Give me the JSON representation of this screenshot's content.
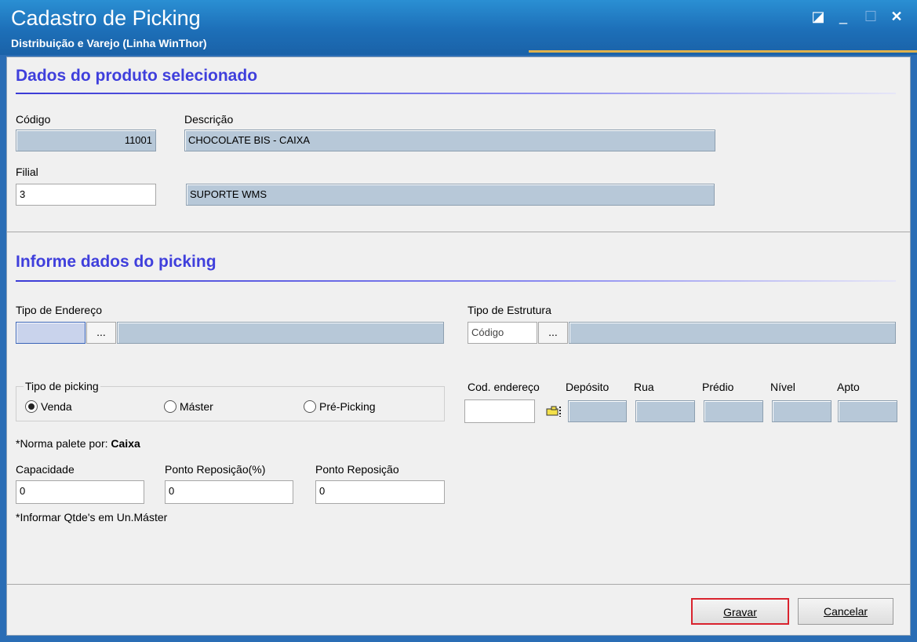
{
  "window": {
    "title": "Cadastro de Picking",
    "subtitle": "Distribuição e Varejo (Linha WinThor)",
    "controls": {
      "restore_icon": "◪",
      "minimize": "_",
      "maximize": "☐",
      "close": "✕"
    }
  },
  "product_section": {
    "title": "Dados do produto selecionado",
    "codigo_label": "Código",
    "codigo_value": "11001",
    "descricao_label": "Descrição",
    "descricao_value": "CHOCOLATE BIS  - CAIXA",
    "filial_label": "Filial",
    "filial_value": "3",
    "filial_name": "SUPORTE WMS"
  },
  "picking_section": {
    "title": "Informe dados do picking",
    "tipo_endereco_label": "Tipo de Endereço",
    "tipo_endereco_value": "",
    "tipo_estrutura_label": "Tipo de Estrutura",
    "tipo_estrutura_placeholder": "Código",
    "browse_label": "...",
    "tipo_picking_label": "Tipo de picking",
    "radios": [
      {
        "label": "Venda",
        "selected": true
      },
      {
        "label": "Máster",
        "selected": false
      },
      {
        "label": "Pré-Picking",
        "selected": false
      }
    ],
    "address_headers": {
      "cod_endereco": "Cod. endereço",
      "deposito": "Depósito",
      "rua": "Rua",
      "predio": "Prédio",
      "nivel": "Nível",
      "apto": "Apto"
    },
    "norma_label": "*Norma palete por:",
    "norma_value": "Caixa",
    "capacidade_label": "Capacidade",
    "capacidade_value": "0",
    "ponto_pct_label": "Ponto Reposição(%)",
    "ponto_pct_value": "0",
    "ponto_label": "Ponto Reposição",
    "ponto_value": "0",
    "info_note": "*Informar Qtde's em Un.Máster"
  },
  "footer": {
    "gravar_label": "Gravar",
    "cancelar_label": "Cancelar"
  },
  "colors": {
    "accent_title": "#3f3fdc",
    "focus_border": "#d9232e"
  }
}
